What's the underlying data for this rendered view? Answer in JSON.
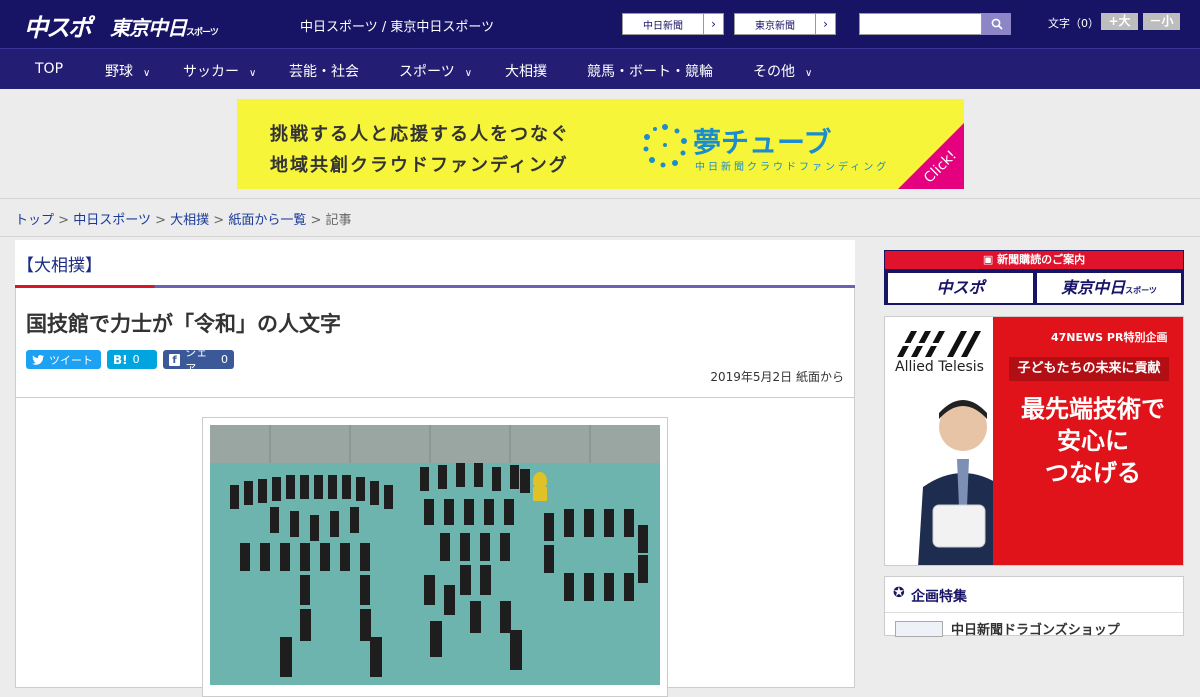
{
  "header": {
    "logo_chuspo": "中スポ",
    "logo_tokyo": "東京中日",
    "logo_tokyo_small": "スポーツ",
    "site_title": "中日スポーツ / 東京中日スポーツ",
    "newspaper_links": [
      "中日新聞",
      "東京新聞"
    ],
    "search": {
      "placeholder": ""
    },
    "font_size_label": "文字（0）",
    "font_bigger": "+大",
    "font_smaller": "－小"
  },
  "nav": {
    "items": [
      {
        "label": "TOP",
        "dropdown": false
      },
      {
        "label": "野球",
        "dropdown": true
      },
      {
        "label": "サッカー",
        "dropdown": true
      },
      {
        "label": "芸能・社会",
        "dropdown": false
      },
      {
        "label": "スポーツ",
        "dropdown": true
      },
      {
        "label": "大相撲",
        "dropdown": false
      },
      {
        "label": "競馬・ボート・競輪",
        "dropdown": false
      },
      {
        "label": "その他",
        "dropdown": true
      }
    ]
  },
  "banner": {
    "line1": "挑戦する人と応援する人をつなぐ",
    "line2": "地域共創クラウドファンディング",
    "brand": "夢チューブ",
    "brand_sub": "中日新聞クラウドファンディング",
    "click": "Click!"
  },
  "breadcrumb": {
    "items": [
      "トップ",
      "中日スポーツ",
      "大相撲",
      "紙面から一覧"
    ],
    "current": "記事",
    "separator": ">"
  },
  "article": {
    "category": "【大相撲】",
    "headline": "国技館で力士が「令和」の人文字",
    "share": {
      "tweet": "ツイート",
      "hatena": "B!",
      "hatena_count": "0",
      "facebook": "シェア",
      "facebook_count": "0"
    },
    "date": "2019年5月2日 紙面から"
  },
  "sidebar": {
    "subscribe_title": "新聞購読のご案内",
    "subscribe_a": "中スポ",
    "subscribe_b": "東京中日",
    "subscribe_b_small": "スポーツ",
    "pr_tag": "47NEWS PR特別企画",
    "pr_pill": "子どもたちの未来に貢献",
    "pr_big": [
      "最先端技術で",
      "安心に",
      "つなげる"
    ],
    "pr_brand": "Allied Telesis",
    "feature_title": "企画特集",
    "feature_item": "中日新聞ドラゴンズショップ"
  },
  "colors": {
    "header_bg": "#171466",
    "nav_bg": "#231e73",
    "accent_red": "#d8162a",
    "banner_yellow": "#f6f53a",
    "twitter": "#1da1f2",
    "hatena": "#00a4de",
    "facebook": "#3b5998"
  }
}
